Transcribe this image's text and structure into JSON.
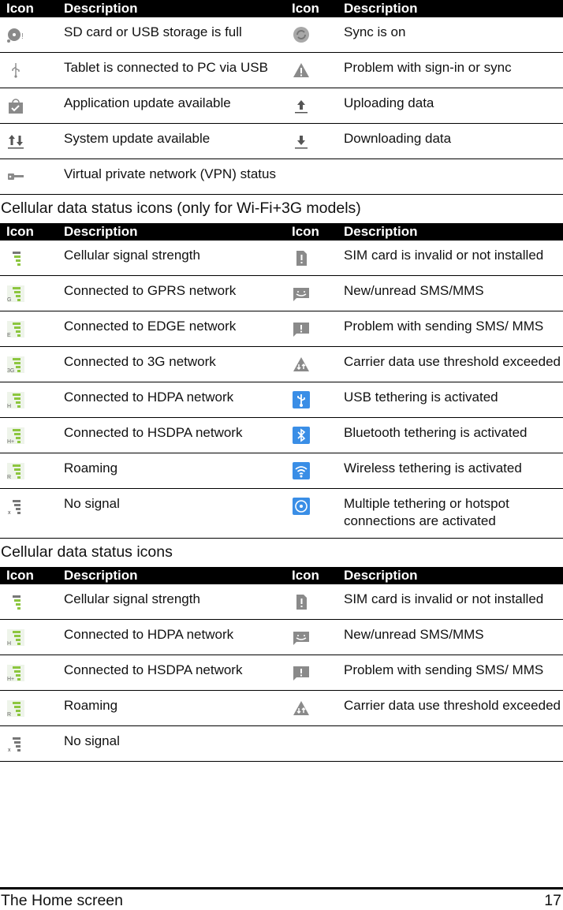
{
  "table_headers": {
    "icon": "Icon",
    "description": "Description"
  },
  "tables": [
    {
      "title": "",
      "rows": [
        {
          "left": {
            "icon": "sd-card-full-icon",
            "text": "SD card or USB storage is full"
          },
          "right": {
            "icon": "sync-icon",
            "text": "Sync is on"
          }
        },
        {
          "left": {
            "icon": "usb-icon",
            "text": "Tablet is connected to PC via USB"
          },
          "right": {
            "icon": "warning-icon",
            "text": "Problem with sign-in or sync"
          }
        },
        {
          "left": {
            "icon": "app-update-icon",
            "text": "Application update available"
          },
          "right": {
            "icon": "upload-icon",
            "text": "Uploading data"
          }
        },
        {
          "left": {
            "icon": "system-update-icon",
            "text": "System update available"
          },
          "right": {
            "icon": "download-icon",
            "text": "Downloading data"
          }
        },
        {
          "left": {
            "icon": "vpn-key-icon",
            "text": "Virtual private network (VPN) status"
          },
          "right": {
            "icon": "",
            "text": ""
          }
        }
      ]
    },
    {
      "title": "Cellular data status icons (only for Wi-Fi+3G models)",
      "rows": [
        {
          "left": {
            "icon": "signal-strength-icon",
            "text": "Cellular signal strength"
          },
          "right": {
            "icon": "sim-invalid-icon",
            "text": "SIM card is invalid or not installed"
          }
        },
        {
          "left": {
            "icon": "signal-gprs-icon",
            "badge": "G",
            "text": "Connected to GPRS network"
          },
          "right": {
            "icon": "sms-new-icon",
            "text": "New/unread SMS/MMS"
          }
        },
        {
          "left": {
            "icon": "signal-edge-icon",
            "badge": "E",
            "text": "Connected to EDGE network"
          },
          "right": {
            "icon": "sms-problem-icon",
            "text": "Problem with sending SMS/ MMS"
          }
        },
        {
          "left": {
            "icon": "signal-3g-icon",
            "badge": "3G",
            "text": "Connected to 3G network"
          },
          "right": {
            "icon": "data-threshold-icon",
            "text": "Carrier data use threshold exceeded"
          }
        },
        {
          "left": {
            "icon": "signal-hdpa-icon",
            "badge": "H",
            "text": "Connected to HDPA network"
          },
          "right": {
            "icon": "usb-tethering-icon",
            "text": "USB tethering is activated"
          }
        },
        {
          "left": {
            "icon": "signal-hsdpa-icon",
            "badge": "H+",
            "text": "Connected to HSDPA network"
          },
          "right": {
            "icon": "bluetooth-tethering-icon",
            "text": "Bluetooth tethering is activated"
          }
        },
        {
          "left": {
            "icon": "signal-roaming-icon",
            "badge": "R",
            "text": "Roaming"
          },
          "right": {
            "icon": "wifi-tethering-icon",
            "text": "Wireless tethering is activated"
          }
        },
        {
          "left": {
            "icon": "no-signal-icon",
            "badge": "x",
            "text": "No signal"
          },
          "right": {
            "icon": "hotspot-icon",
            "text": "Multiple tethering or hotspot connections are activated"
          }
        }
      ]
    },
    {
      "title": "Cellular data status icons",
      "rows": [
        {
          "left": {
            "icon": "signal-strength-icon",
            "text": "Cellular signal strength"
          },
          "right": {
            "icon": "sim-invalid-icon",
            "text": "SIM card is invalid or not installed"
          }
        },
        {
          "left": {
            "icon": "signal-hdpa-icon",
            "badge": "H",
            "text": "Connected to HDPA network"
          },
          "right": {
            "icon": "sms-new-icon",
            "text": "New/unread SMS/MMS"
          }
        },
        {
          "left": {
            "icon": "signal-hsdpa-icon",
            "badge": "H+",
            "text": "Connected to HSDPA network"
          },
          "right": {
            "icon": "sms-problem-icon",
            "text": "Problem with sending SMS/ MMS"
          }
        },
        {
          "left": {
            "icon": "signal-roaming-icon",
            "badge": "R",
            "text": "Roaming"
          },
          "right": {
            "icon": "data-threshold-icon",
            "text": "Carrier data use threshold exceeded"
          }
        },
        {
          "left": {
            "icon": "no-signal-icon",
            "badge": "x",
            "text": "No signal"
          },
          "right": {
            "icon": "",
            "text": ""
          }
        }
      ]
    }
  ],
  "colors": {
    "signal_green": "#8cc63f",
    "icon_gray": "#8a8a8a",
    "tether_blue": "#3a8ee6",
    "header_bg": "#000000"
  },
  "footer": {
    "section": "The Home screen",
    "page_number": "17"
  }
}
